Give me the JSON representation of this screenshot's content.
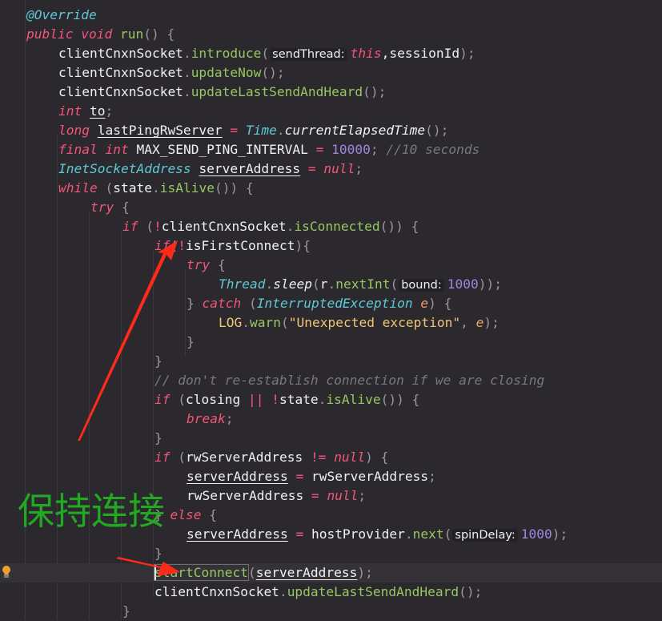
{
  "editor": {
    "annotation_text": "保持连接",
    "colors": {
      "background": "#2b292e",
      "keyword": "#f2567a",
      "function": "#96c862",
      "type": "#5fc9d6",
      "number": "#9c88e0",
      "string": "#f0c674",
      "comment": "#7a7780",
      "annotation_label": "#23a823",
      "arrow": "#ff2a1a",
      "bulb": "#f0a030"
    },
    "lines": [
      {
        "indent": 1,
        "tokens": [
          {
            "t": "@Override",
            "c": "ann"
          }
        ]
      },
      {
        "indent": 1,
        "tokens": [
          {
            "t": "public void ",
            "c": "kw"
          },
          {
            "t": "run",
            "c": "fn"
          },
          {
            "t": "() {",
            "c": "punc"
          }
        ]
      },
      {
        "indent": 2,
        "tokens": [
          {
            "t": "clientCnxnSocket",
            "c": "plain"
          },
          {
            "t": ".",
            "c": "punc"
          },
          {
            "t": "introduce",
            "c": "fn"
          },
          {
            "t": "(",
            "c": "punc"
          },
          {
            "hint": "sendThread:"
          },
          {
            "t": "this",
            "c": "kw"
          },
          {
            "t": ",sessionId",
            "c": "plain"
          },
          {
            "t": ");",
            "c": "punc"
          }
        ]
      },
      {
        "indent": 2,
        "tokens": [
          {
            "t": "clientCnxnSocket",
            "c": "plain"
          },
          {
            "t": ".",
            "c": "punc"
          },
          {
            "t": "updateNow",
            "c": "fn"
          },
          {
            "t": "();",
            "c": "punc"
          }
        ]
      },
      {
        "indent": 2,
        "tokens": [
          {
            "t": "clientCnxnSocket",
            "c": "plain"
          },
          {
            "t": ".",
            "c": "punc"
          },
          {
            "t": "updateLastSendAndHeard",
            "c": "fn"
          },
          {
            "t": "();",
            "c": "punc"
          }
        ]
      },
      {
        "indent": 2,
        "tokens": [
          {
            "t": "int ",
            "c": "kw"
          },
          {
            "t": "to",
            "c": "var"
          },
          {
            "t": ";",
            "c": "punc"
          }
        ]
      },
      {
        "indent": 2,
        "tokens": [
          {
            "t": "long ",
            "c": "kw"
          },
          {
            "t": "lastPingRwServer",
            "c": "var"
          },
          {
            "t": " = ",
            "c": "op"
          },
          {
            "t": "Time",
            "c": "type"
          },
          {
            "t": ".",
            "c": "punc"
          },
          {
            "t": "currentElapsedTime",
            "c": "static"
          },
          {
            "t": "();",
            "c": "punc"
          }
        ]
      },
      {
        "indent": 2,
        "tokens": [
          {
            "t": "final int ",
            "c": "kw"
          },
          {
            "t": "MAX_SEND_PING_INTERVAL",
            "c": "plain"
          },
          {
            "t": " = ",
            "c": "op"
          },
          {
            "t": "10000",
            "c": "num"
          },
          {
            "t": "; ",
            "c": "punc"
          },
          {
            "t": "//10 seconds",
            "c": "cmt"
          }
        ]
      },
      {
        "indent": 2,
        "tokens": [
          {
            "t": "InetSocketAddress ",
            "c": "type"
          },
          {
            "t": "serverAddress",
            "c": "var"
          },
          {
            "t": " = ",
            "c": "op"
          },
          {
            "t": "null",
            "c": "kw"
          },
          {
            "t": ";",
            "c": "punc"
          }
        ]
      },
      {
        "indent": 2,
        "tokens": [
          {
            "t": "while ",
            "c": "kw"
          },
          {
            "t": "(",
            "c": "punc"
          },
          {
            "t": "state",
            "c": "plain"
          },
          {
            "t": ".",
            "c": "punc"
          },
          {
            "t": "isAlive",
            "c": "fn"
          },
          {
            "t": "()) {",
            "c": "punc"
          }
        ]
      },
      {
        "indent": 3,
        "tokens": [
          {
            "t": "try ",
            "c": "kw"
          },
          {
            "t": "{",
            "c": "punc"
          }
        ]
      },
      {
        "indent": 4,
        "tokens": [
          {
            "t": "if ",
            "c": "kw"
          },
          {
            "t": "(",
            "c": "punc"
          },
          {
            "t": "!",
            "c": "op"
          },
          {
            "t": "clientCnxnSocket",
            "c": "plain"
          },
          {
            "t": ".",
            "c": "punc"
          },
          {
            "t": "isConnected",
            "c": "fn"
          },
          {
            "t": "()) {",
            "c": "punc"
          }
        ]
      },
      {
        "indent": 5,
        "tokens": [
          {
            "t": "if",
            "c": "kw"
          },
          {
            "t": "(",
            "c": "punc"
          },
          {
            "t": "!",
            "c": "op"
          },
          {
            "t": "isFirstConnect",
            "c": "plain"
          },
          {
            "t": "){",
            "c": "punc"
          }
        ]
      },
      {
        "indent": 6,
        "tokens": [
          {
            "t": "try ",
            "c": "kw"
          },
          {
            "t": "{",
            "c": "punc"
          }
        ]
      },
      {
        "indent": 7,
        "tokens": [
          {
            "t": "Thread",
            "c": "type"
          },
          {
            "t": ".",
            "c": "punc"
          },
          {
            "t": "sleep",
            "c": "static"
          },
          {
            "t": "(",
            "c": "punc"
          },
          {
            "t": "r",
            "c": "plain"
          },
          {
            "t": ".",
            "c": "punc"
          },
          {
            "t": "nextInt",
            "c": "fn"
          },
          {
            "t": "(",
            "c": "punc"
          },
          {
            "hint": "bound:"
          },
          {
            "t": "1000",
            "c": "num"
          },
          {
            "t": "));",
            "c": "punc"
          }
        ]
      },
      {
        "indent": 6,
        "tokens": [
          {
            "t": "} ",
            "c": "punc"
          },
          {
            "t": "catch ",
            "c": "kw"
          },
          {
            "t": "(",
            "c": "punc"
          },
          {
            "t": "InterruptedException ",
            "c": "type"
          },
          {
            "t": "e",
            "c": "param"
          },
          {
            "t": ") {",
            "c": "punc"
          }
        ]
      },
      {
        "indent": 7,
        "tokens": [
          {
            "t": "LOG",
            "c": "str"
          },
          {
            "t": ".",
            "c": "punc"
          },
          {
            "t": "warn",
            "c": "fn"
          },
          {
            "t": "(",
            "c": "punc"
          },
          {
            "t": "\"Unexpected exception\"",
            "c": "str"
          },
          {
            "t": ", ",
            "c": "punc"
          },
          {
            "t": "e",
            "c": "param"
          },
          {
            "t": ");",
            "c": "punc"
          }
        ]
      },
      {
        "indent": 6,
        "tokens": [
          {
            "t": "}",
            "c": "punc"
          }
        ]
      },
      {
        "indent": 5,
        "tokens": [
          {
            "t": "}",
            "c": "punc"
          }
        ]
      },
      {
        "indent": 5,
        "tokens": [
          {
            "t": "// don't re-establish connection if we are closing",
            "c": "cmt"
          }
        ]
      },
      {
        "indent": 5,
        "tokens": [
          {
            "t": "if ",
            "c": "kw"
          },
          {
            "t": "(",
            "c": "punc"
          },
          {
            "t": "closing ",
            "c": "plain"
          },
          {
            "t": "|| !",
            "c": "op"
          },
          {
            "t": "state",
            "c": "plain"
          },
          {
            "t": ".",
            "c": "punc"
          },
          {
            "t": "isAlive",
            "c": "fn"
          },
          {
            "t": "()) {",
            "c": "punc"
          }
        ]
      },
      {
        "indent": 6,
        "tokens": [
          {
            "t": "break",
            "c": "kw"
          },
          {
            "t": ";",
            "c": "punc"
          }
        ]
      },
      {
        "indent": 5,
        "tokens": [
          {
            "t": "}",
            "c": "punc"
          }
        ]
      },
      {
        "indent": 5,
        "tokens": [
          {
            "t": "if ",
            "c": "kw"
          },
          {
            "t": "(",
            "c": "punc"
          },
          {
            "t": "rwServerAddress ",
            "c": "plain"
          },
          {
            "t": "!= ",
            "c": "op"
          },
          {
            "t": "null",
            "c": "kw"
          },
          {
            "t": ") {",
            "c": "punc"
          }
        ]
      },
      {
        "indent": 6,
        "tokens": [
          {
            "t": "serverAddress",
            "c": "var"
          },
          {
            "t": " = ",
            "c": "op"
          },
          {
            "t": "rwServerAddress",
            "c": "plain"
          },
          {
            "t": ";",
            "c": "punc"
          }
        ]
      },
      {
        "indent": 6,
        "tokens": [
          {
            "t": "rwServerAddress",
            "c": "plain"
          },
          {
            "t": " = ",
            "c": "op"
          },
          {
            "t": "null",
            "c": "kw"
          },
          {
            "t": ";",
            "c": "punc"
          }
        ]
      },
      {
        "indent": 5,
        "tokens": [
          {
            "t": "} ",
            "c": "punc"
          },
          {
            "t": "else ",
            "c": "kw"
          },
          {
            "t": "{",
            "c": "punc"
          }
        ]
      },
      {
        "indent": 6,
        "tokens": [
          {
            "t": "serverAddress",
            "c": "var"
          },
          {
            "t": " = ",
            "c": "op"
          },
          {
            "t": "hostProvider",
            "c": "plain"
          },
          {
            "t": ".",
            "c": "punc"
          },
          {
            "t": "next",
            "c": "fn"
          },
          {
            "t": "(",
            "c": "punc"
          },
          {
            "hint": "spinDelay:"
          },
          {
            "t": "1000",
            "c": "num"
          },
          {
            "t": ");",
            "c": "punc"
          }
        ]
      },
      {
        "indent": 5,
        "tokens": [
          {
            "t": "}",
            "c": "punc"
          }
        ]
      },
      {
        "indent": 5,
        "current": true,
        "tokens": [
          {
            "caret": true
          },
          {
            "t": "startConnect",
            "c": "fn",
            "box": true
          },
          {
            "t": "(",
            "c": "punc"
          },
          {
            "t": "serverAddress",
            "c": "var"
          },
          {
            "t": ");",
            "c": "punc"
          }
        ]
      },
      {
        "indent": 5,
        "tokens": [
          {
            "t": "clientCnxnSocket",
            "c": "plain"
          },
          {
            "t": ".",
            "c": "punc"
          },
          {
            "t": "updateLastSendAndHeard",
            "c": "fn"
          },
          {
            "t": "();",
            "c": "punc"
          }
        ]
      },
      {
        "indent": 4,
        "tokens": [
          {
            "t": "}",
            "c": "punc"
          }
        ]
      }
    ]
  }
}
